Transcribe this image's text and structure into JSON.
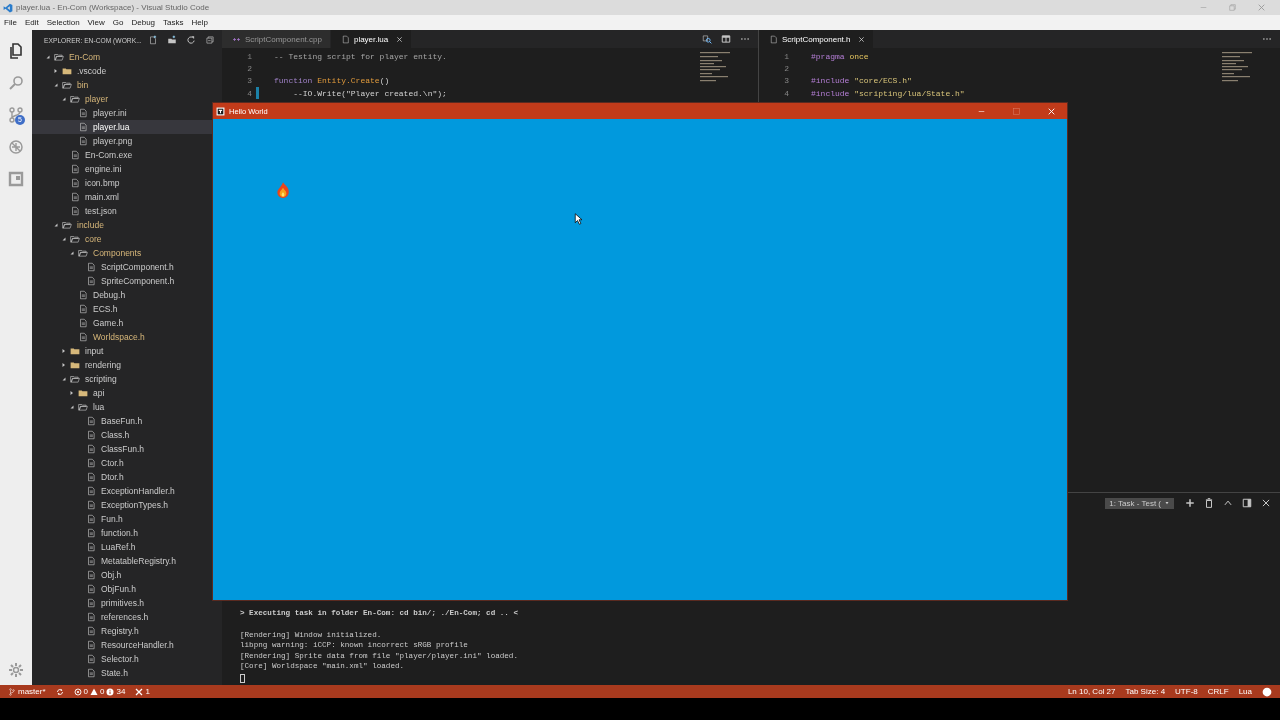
{
  "window": {
    "title": "player.lua - En-Com (Workspace) - Visual Studio Code"
  },
  "menu": [
    "File",
    "Edit",
    "Selection",
    "View",
    "Go",
    "Debug",
    "Tasks",
    "Help"
  ],
  "activity_bar": [
    {
      "kind": "explorer",
      "selected": true
    },
    {
      "kind": "search",
      "selected": false
    },
    {
      "kind": "scm",
      "selected": false,
      "badge": "5"
    },
    {
      "kind": "debug",
      "selected": false
    },
    {
      "kind": "extensions",
      "selected": false
    }
  ],
  "sidebar": {
    "title": "EXPLORER: EN-COM (WORK...",
    "tree": [
      {
        "name": "En-Com",
        "kind": "folder",
        "expanded": true,
        "modified": true,
        "selected": false,
        "children": [
          {
            "name": ".vscode",
            "kind": "folder",
            "expanded": false,
            "modified": false,
            "selected": false
          },
          {
            "name": "bin",
            "kind": "folder",
            "expanded": true,
            "modified": true,
            "selected": false,
            "children": [
              {
                "name": "player",
                "kind": "folder",
                "expanded": true,
                "modified": true,
                "selected": false,
                "children": [
                  {
                    "name": "player.ini",
                    "kind": "file",
                    "modified": false,
                    "selected": false
                  },
                  {
                    "name": "player.lua",
                    "kind": "file",
                    "modified": false,
                    "selected": true
                  },
                  {
                    "name": "player.png",
                    "kind": "file",
                    "modified": false,
                    "selected": false
                  }
                ]
              },
              {
                "name": "En-Com.exe",
                "kind": "file",
                "modified": false,
                "selected": false
              },
              {
                "name": "engine.ini",
                "kind": "file",
                "modified": false,
                "selected": false
              },
              {
                "name": "icon.bmp",
                "kind": "file",
                "modified": false,
                "selected": false
              },
              {
                "name": "main.xml",
                "kind": "file",
                "modified": false,
                "selected": false
              },
              {
                "name": "test.json",
                "kind": "file",
                "modified": false,
                "selected": false
              }
            ]
          },
          {
            "name": "include",
            "kind": "folder",
            "expanded": true,
            "modified": true,
            "selected": false,
            "children": [
              {
                "name": "core",
                "kind": "folder",
                "expanded": true,
                "modified": true,
                "selected": false,
                "children": [
                  {
                    "name": "Components",
                    "kind": "folder",
                    "expanded": true,
                    "modified": true,
                    "selected": false,
                    "children": [
                      {
                        "name": "ScriptComponent.h",
                        "kind": "file",
                        "modified": false,
                        "selected": false
                      },
                      {
                        "name": "SpriteComponent.h",
                        "kind": "file",
                        "modified": false,
                        "selected": false
                      }
                    ]
                  },
                  {
                    "name": "Debug.h",
                    "kind": "file",
                    "modified": false,
                    "selected": false
                  },
                  {
                    "name": "ECS.h",
                    "kind": "file",
                    "modified": false,
                    "selected": false
                  },
                  {
                    "name": "Game.h",
                    "kind": "file",
                    "modified": false,
                    "selected": false
                  },
                  {
                    "name": "Worldspace.h",
                    "kind": "file",
                    "modified": true,
                    "selected": false
                  }
                ]
              },
              {
                "name": "input",
                "kind": "folder",
                "expanded": false,
                "modified": false,
                "selected": false
              },
              {
                "name": "rendering",
                "kind": "folder",
                "expanded": false,
                "modified": false,
                "selected": false
              },
              {
                "name": "scripting",
                "kind": "folder",
                "expanded": true,
                "modified": false,
                "selected": false,
                "children": [
                  {
                    "name": "api",
                    "kind": "folder",
                    "expanded": false,
                    "modified": false,
                    "selected": false
                  },
                  {
                    "name": "lua",
                    "kind": "folder",
                    "expanded": true,
                    "modified": false,
                    "selected": false,
                    "children": [
                      {
                        "name": "BaseFun.h",
                        "kind": "file",
                        "modified": false,
                        "selected": false
                      },
                      {
                        "name": "Class.h",
                        "kind": "file",
                        "modified": false,
                        "selected": false
                      },
                      {
                        "name": "ClassFun.h",
                        "kind": "file",
                        "modified": false,
                        "selected": false
                      },
                      {
                        "name": "Ctor.h",
                        "kind": "file",
                        "modified": false,
                        "selected": false
                      },
                      {
                        "name": "Dtor.h",
                        "kind": "file",
                        "modified": false,
                        "selected": false
                      },
                      {
                        "name": "ExceptionHandler.h",
                        "kind": "file",
                        "modified": false,
                        "selected": false
                      },
                      {
                        "name": "ExceptionTypes.h",
                        "kind": "file",
                        "modified": false,
                        "selected": false
                      },
                      {
                        "name": "Fun.h",
                        "kind": "file",
                        "modified": false,
                        "selected": false
                      },
                      {
                        "name": "function.h",
                        "kind": "file",
                        "modified": false,
                        "selected": false
                      },
                      {
                        "name": "LuaRef.h",
                        "kind": "file",
                        "modified": false,
                        "selected": false
                      },
                      {
                        "name": "MetatableRegistry.h",
                        "kind": "file",
                        "modified": false,
                        "selected": false
                      },
                      {
                        "name": "Obj.h",
                        "kind": "file",
                        "modified": false,
                        "selected": false
                      },
                      {
                        "name": "ObjFun.h",
                        "kind": "file",
                        "modified": false,
                        "selected": false
                      },
                      {
                        "name": "primitives.h",
                        "kind": "file",
                        "modified": false,
                        "selected": false
                      },
                      {
                        "name": "references.h",
                        "kind": "file",
                        "modified": false,
                        "selected": false
                      },
                      {
                        "name": "Registry.h",
                        "kind": "file",
                        "modified": false,
                        "selected": false
                      },
                      {
                        "name": "ResourceHandler.h",
                        "kind": "file",
                        "modified": false,
                        "selected": false
                      },
                      {
                        "name": "Selector.h",
                        "kind": "file",
                        "modified": false,
                        "selected": false
                      },
                      {
                        "name": "State.h",
                        "kind": "file",
                        "modified": false,
                        "selected": false
                      }
                    ]
                  }
                ]
              }
            ]
          }
        ]
      }
    ]
  },
  "editor_groups": [
    {
      "tabs": [
        {
          "label": "ScriptComponent.cpp",
          "kind": "cpp",
          "selected": false
        },
        {
          "label": "player.lua",
          "kind": "lua",
          "selected": true
        }
      ],
      "lines": [
        {
          "number": "1",
          "changed": false,
          "tokens": [
            {
              "kind": "comment",
              "text": "-- Testing script for player entity."
            }
          ]
        },
        {
          "number": "2",
          "changed": false
        },
        {
          "number": "3",
          "changed": false,
          "tokens": [
            {
              "kind": "keyword",
              "text": "function"
            },
            {
              "kind": "function",
              "text": " Entity.Create"
            },
            {
              "kind": "plain",
              "text": "()"
            }
          ]
        },
        {
          "number": "4",
          "changed": true,
          "tokens": [
            {
              "kind": "plain",
              "text": "    --IO.Write(\"Player created.\\n\");"
            }
          ]
        }
      ]
    },
    {
      "tabs": [
        {
          "label": "ScriptComponent.h",
          "kind": "header",
          "selected": true
        }
      ],
      "lines": [
        {
          "number": "1",
          "changed": false,
          "tokens": [
            {
              "kind": "directive",
              "text": "#pragma"
            },
            {
              "kind": "value",
              "text": " once"
            }
          ]
        },
        {
          "number": "2",
          "changed": false
        },
        {
          "number": "3",
          "changed": false,
          "tokens": [
            {
              "kind": "directive",
              "text": "#include"
            },
            {
              "kind": "string",
              "text": " \"core/ECS.h\""
            }
          ]
        },
        {
          "number": "4",
          "changed": false,
          "tokens": [
            {
              "kind": "directive",
              "text": "#include"
            },
            {
              "kind": "string",
              "text": " \"scripting/lua/State.h\""
            }
          ]
        }
      ]
    }
  ],
  "panel": {
    "terminal_selector": "1: Task - Test (",
    "lines": [
      {
        "kind": "task",
        "text": "> Executing task in folder En-Com: cd bin/; ./En-Com; cd .. <"
      },
      {
        "kind": "output",
        "text": "[Rendering] Window initialized."
      },
      {
        "kind": "output",
        "text": "libpng warning: iCCP: known incorrect sRGB profile"
      },
      {
        "kind": "output",
        "text": "[Rendering] Sprite data from file \"player/player.ini\" loaded."
      },
      {
        "kind": "output",
        "text": "[Core] Worldspace \"main.xml\" loaded."
      }
    ]
  },
  "status_bar": {
    "branch": "master*",
    "errors": "0",
    "warnings": "0",
    "infos": "34",
    "tasks": "1",
    "position": "Ln 10, Col 27",
    "indentation": "Tab Size: 4",
    "encoding": "UTF-8",
    "line_ending": "CRLF",
    "language": "Lua"
  },
  "game_window": {
    "title": "Hello World",
    "maximize_disabled": true
  }
}
